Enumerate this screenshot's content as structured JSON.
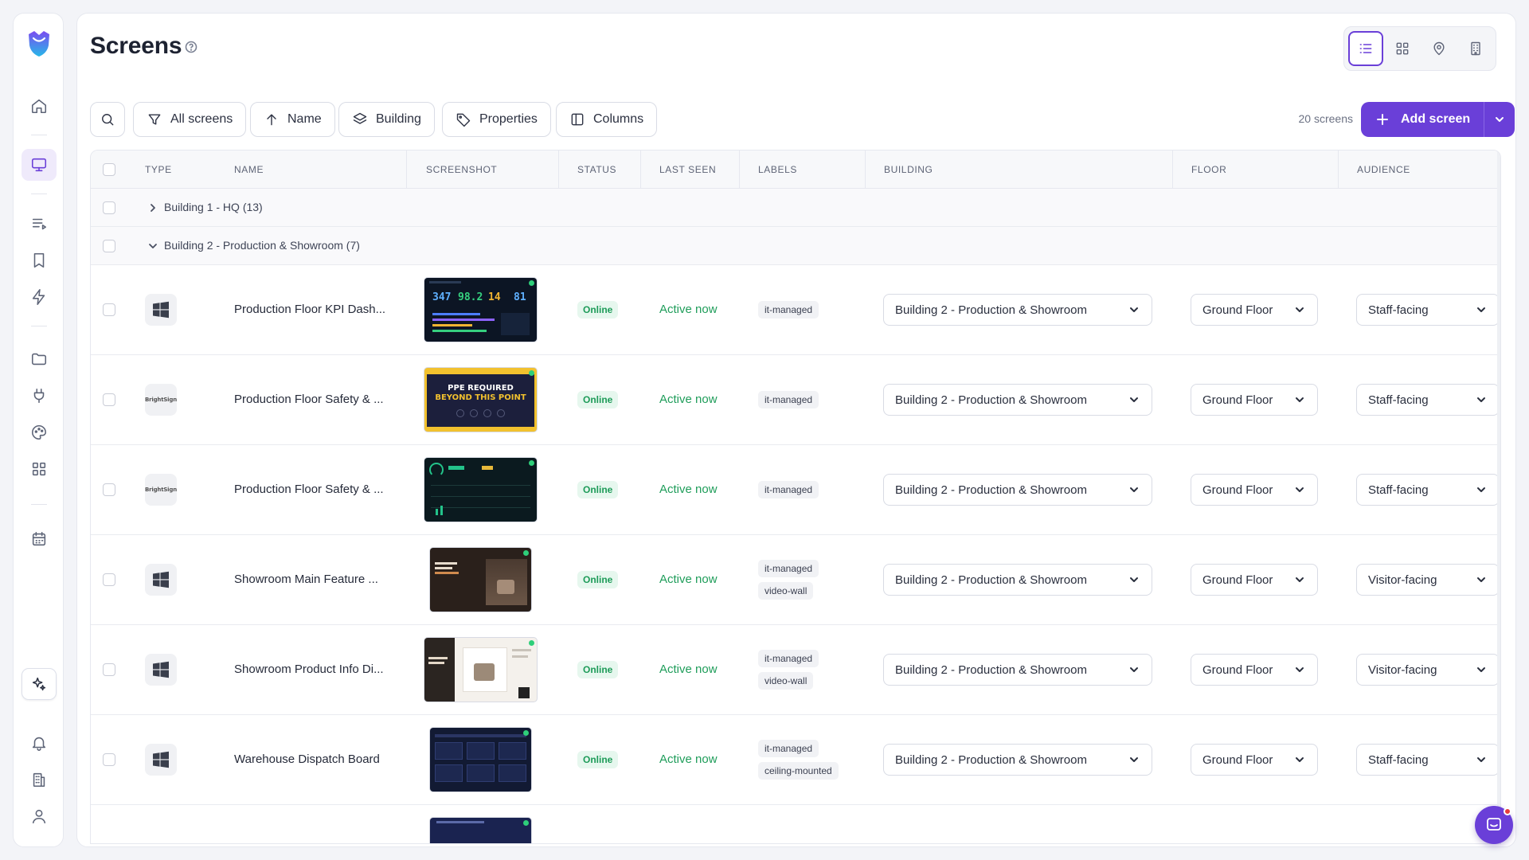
{
  "page": {
    "title": "Screens"
  },
  "toolbar": {
    "filters": [
      {
        "label": "All screens",
        "icon": "filter-icon"
      },
      {
        "label": "Name",
        "icon": "arrow-up-icon"
      },
      {
        "label": "Building",
        "icon": "layers-icon"
      },
      {
        "label": "Properties",
        "icon": "tag-icon"
      },
      {
        "label": "Columns",
        "icon": "columns-icon"
      }
    ],
    "count": "20 screens",
    "add_label": "Add screen"
  },
  "table": {
    "headers": [
      "Type",
      "Name",
      "Screenshot",
      "Status",
      "Last seen",
      "Labels",
      "Building",
      "Floor",
      "Audience"
    ],
    "groups": [
      {
        "label": "Building 1 - HQ (13)",
        "expanded": false
      },
      {
        "label": "Building 2 - Production & Showroom (7)",
        "expanded": true
      }
    ],
    "rows": [
      {
        "type": "windows",
        "name": "Production Floor KPI Dash...",
        "status": "Online",
        "last_seen": "Active now",
        "labels": [
          "it-managed"
        ],
        "building": "Building 2 - Production & Showroom",
        "floor": "Ground Floor",
        "audience": "Staff-facing",
        "thumb": {
          "kind": "kpi",
          "values": [
            "347",
            "98.2",
            "14",
            "81"
          ]
        }
      },
      {
        "type": "brightsign",
        "name": "Production Floor Safety & ...",
        "status": "Online",
        "last_seen": "Active now",
        "labels": [
          "it-managed"
        ],
        "building": "Building 2 - Production & Showroom",
        "floor": "Ground Floor",
        "audience": "Staff-facing",
        "thumb": {
          "kind": "ppe",
          "line1": "PPE REQUIRED",
          "line2": "BEYOND THIS POINT"
        }
      },
      {
        "type": "brightsign",
        "name": "Production Floor Safety & ...",
        "status": "Online",
        "last_seen": "Active now",
        "labels": [
          "it-managed"
        ],
        "building": "Building 2 - Production & Showroom",
        "floor": "Ground Floor",
        "audience": "Staff-facing",
        "thumb": {
          "kind": "dark-dash"
        }
      },
      {
        "type": "windows",
        "name": "Showroom Main Feature ...",
        "status": "Online",
        "last_seen": "Active now",
        "labels": [
          "it-managed",
          "video-wall"
        ],
        "building": "Building 2 - Production & Showroom",
        "floor": "Ground Floor",
        "audience": "Visitor-facing",
        "thumb": {
          "kind": "brown"
        }
      },
      {
        "type": "windows",
        "name": "Showroom Product Info Di...",
        "status": "Online",
        "last_seen": "Active now",
        "labels": [
          "it-managed",
          "video-wall"
        ],
        "building": "Building 2 - Production & Showroom",
        "floor": "Ground Floor",
        "audience": "Visitor-facing",
        "thumb": {
          "kind": "product"
        }
      },
      {
        "type": "windows",
        "name": "Warehouse Dispatch Board",
        "status": "Online",
        "last_seen": "Active now",
        "labels": [
          "it-managed",
          "ceiling-mounted"
        ],
        "building": "Building 2 - Production & Showroom",
        "floor": "Ground Floor",
        "audience": "Staff-facing",
        "thumb": {
          "kind": "dispatch"
        }
      }
    ]
  },
  "sidebar": {
    "items": [
      {
        "name": "home-icon",
        "active": false
      },
      {
        "name": "monitor-icon",
        "active": true
      },
      {
        "name": "playlist-icon",
        "active": false
      },
      {
        "name": "bookmark-icon",
        "active": false
      },
      {
        "name": "lightning-icon",
        "active": false
      },
      {
        "name": "folder-icon",
        "active": false
      },
      {
        "name": "plug-icon",
        "active": false
      },
      {
        "name": "palette-icon",
        "active": false
      },
      {
        "name": "apps-icon",
        "active": false
      },
      {
        "name": "calendar-icon",
        "active": false
      },
      {
        "name": "sparkle-icon",
        "active": false
      },
      {
        "name": "bell-icon",
        "active": false
      },
      {
        "name": "building-icon",
        "active": false
      },
      {
        "name": "user-icon",
        "active": false
      }
    ]
  },
  "colors": {
    "accent": "#6a3fd8",
    "online": "#1d9b58"
  }
}
